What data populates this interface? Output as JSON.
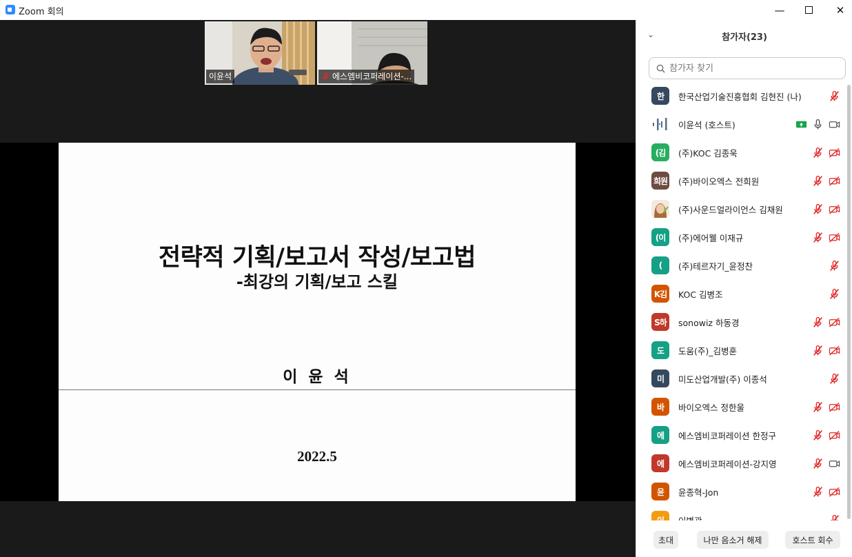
{
  "window": {
    "title": "Zoom 회의",
    "min": "—",
    "close": "✕"
  },
  "videos": [
    {
      "name": "이윤석",
      "muted": false
    },
    {
      "name": "에스엠비코퍼레이션-...",
      "muted": true
    }
  ],
  "slide": {
    "title": "전략적 기획/보고서 작성/보고법",
    "subtitle": "-최강의 기획/보고 스킬",
    "author": "이 윤 석",
    "date": "2022.5"
  },
  "panel": {
    "title": "참가자(23)",
    "search_placeholder": "참가자 찾기",
    "participants": [
      {
        "avatar": "한",
        "color": "#34495e",
        "name": "한국산업기술진흥협회 김현진 (나)",
        "mic": "muted",
        "video": "none"
      },
      {
        "avatar": "",
        "color": "#ffffff",
        "name": "이윤석 (호스트)",
        "mic": "on",
        "video": "on",
        "sharing": true
      },
      {
        "avatar": "(김",
        "color": "#27ae60",
        "name": "(주)KOC 김종욱",
        "mic": "muted",
        "video": "off"
      },
      {
        "avatar": "희원",
        "color": "#6d4c41",
        "name": "(주)바이오엑스 전희원",
        "mic": "muted",
        "video": "off"
      },
      {
        "avatar": "",
        "color": "#f0c08c",
        "name": "(주)사운드얼라이언스 김채원",
        "mic": "muted",
        "video": "off"
      },
      {
        "avatar": "(이",
        "color": "#16a085",
        "name": "(주)에어웰  이재규",
        "mic": "muted",
        "video": "off"
      },
      {
        "avatar": "(",
        "color": "#16a085",
        "name": "(주)테르자기_윤정찬",
        "mic": "muted",
        "video": "none"
      },
      {
        "avatar": "K김",
        "color": "#d35400",
        "name": "KOC 김병조",
        "mic": "muted",
        "video": "none"
      },
      {
        "avatar": "S하",
        "color": "#c0392b",
        "name": "sonowiz 하동경",
        "mic": "muted",
        "video": "off"
      },
      {
        "avatar": "도",
        "color": "#16a085",
        "name": "도움(주)_김병훈",
        "mic": "muted",
        "video": "off"
      },
      {
        "avatar": "미",
        "color": "#34495e",
        "name": "미도산업개발(주) 이종석",
        "mic": "muted",
        "video": "none"
      },
      {
        "avatar": "바",
        "color": "#d35400",
        "name": "바이오엑스 정한울",
        "mic": "muted",
        "video": "off"
      },
      {
        "avatar": "에",
        "color": "#16a085",
        "name": "에스엠비코퍼레이션 한정구",
        "mic": "muted",
        "video": "off"
      },
      {
        "avatar": "에",
        "color": "#c0392b",
        "name": "에스엠비코퍼레이션-강지영",
        "mic": "muted",
        "video": "on"
      },
      {
        "avatar": "윤",
        "color": "#d35400",
        "name": "윤종혁-Jon",
        "mic": "muted",
        "video": "off"
      },
      {
        "avatar": "이",
        "color": "#f39c12",
        "name": "이병관",
        "mic": "muted",
        "video": "none"
      }
    ],
    "buttons": {
      "invite": "초대",
      "unmute_me": "나만 음소거 해제",
      "reclaim_host": "호스트 회수"
    }
  }
}
